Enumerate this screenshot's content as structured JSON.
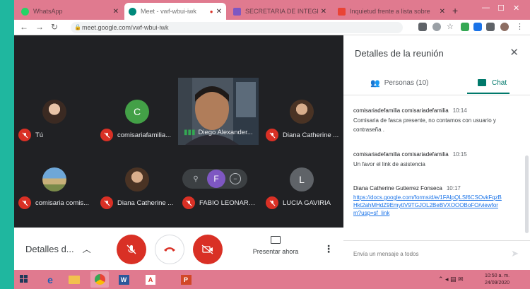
{
  "browser": {
    "tabs": [
      {
        "label": "WhatsApp",
        "active": false,
        "icon": "whatsapp-icon",
        "color": "#25d366"
      },
      {
        "label": "Meet - vwf-wbui-iwk",
        "active": true,
        "icon": "meet-icon",
        "color": "#00897b"
      },
      {
        "label": "SECRETARIA DE INTEGRACION",
        "active": false,
        "icon": "form-icon",
        "color": "#7e57c2"
      },
      {
        "label": "Inquietud frente a lista sobre",
        "active": false,
        "icon": "doc-icon",
        "color": "#ea4335"
      }
    ],
    "url": "meet.google.com/vwf-wbui-iwk"
  },
  "participants": [
    {
      "name": "Tú"
    },
    {
      "name": "comisariafamilia...",
      "initial": "C"
    },
    {
      "name": "Diego Alexander..."
    },
    {
      "name": "Diana Catherine ..."
    },
    {
      "name": "comisaria comis..."
    },
    {
      "name": "Diana Catherine ..."
    },
    {
      "name": "FABIO LEONARD...",
      "initial": "F"
    },
    {
      "name": "LUCIA GAVIRIA",
      "initial": "L"
    }
  ],
  "controls": {
    "details_label": "Detalles d...",
    "present_label": "Presentar ahora"
  },
  "panel": {
    "title": "Detalles de la reunión",
    "tab_people": "Personas (10)",
    "tab_chat": "Chat",
    "messages": [
      {
        "sender": "comisariadefamilia comisariadefamilia",
        "time": "10:14",
        "text": "Comisaria de  fasca presente, no contamos con usuario y contraseña ."
      },
      {
        "sender": "comisariadefamilia comisariadefamilia",
        "time": "10:15",
        "text": "Un favor el link de asistencia"
      },
      {
        "sender": "Diana Catherine Gutierrez Fonseca",
        "time": "10:17",
        "link": "https://docs.google.com/forms/d/e/1FAIpQLSf6CSOvkFqzBHkt2ahMHdZ9EmyttV9TGJOL2BeBVXOOOBoFO/viewform?usp=sf_link"
      }
    ],
    "compose_placeholder": "Envía un mensaje a todos"
  },
  "taskbar": {
    "clock_time": "10:50 a. m.",
    "clock_date": "24/09/2020"
  },
  "colors": {
    "meet_bg": "#202124",
    "mic_off_red": "#d93025",
    "meet_teal": "#00796b",
    "frame_teal": "#1fb79f",
    "tabstrip_pink": "#e07a8f"
  }
}
